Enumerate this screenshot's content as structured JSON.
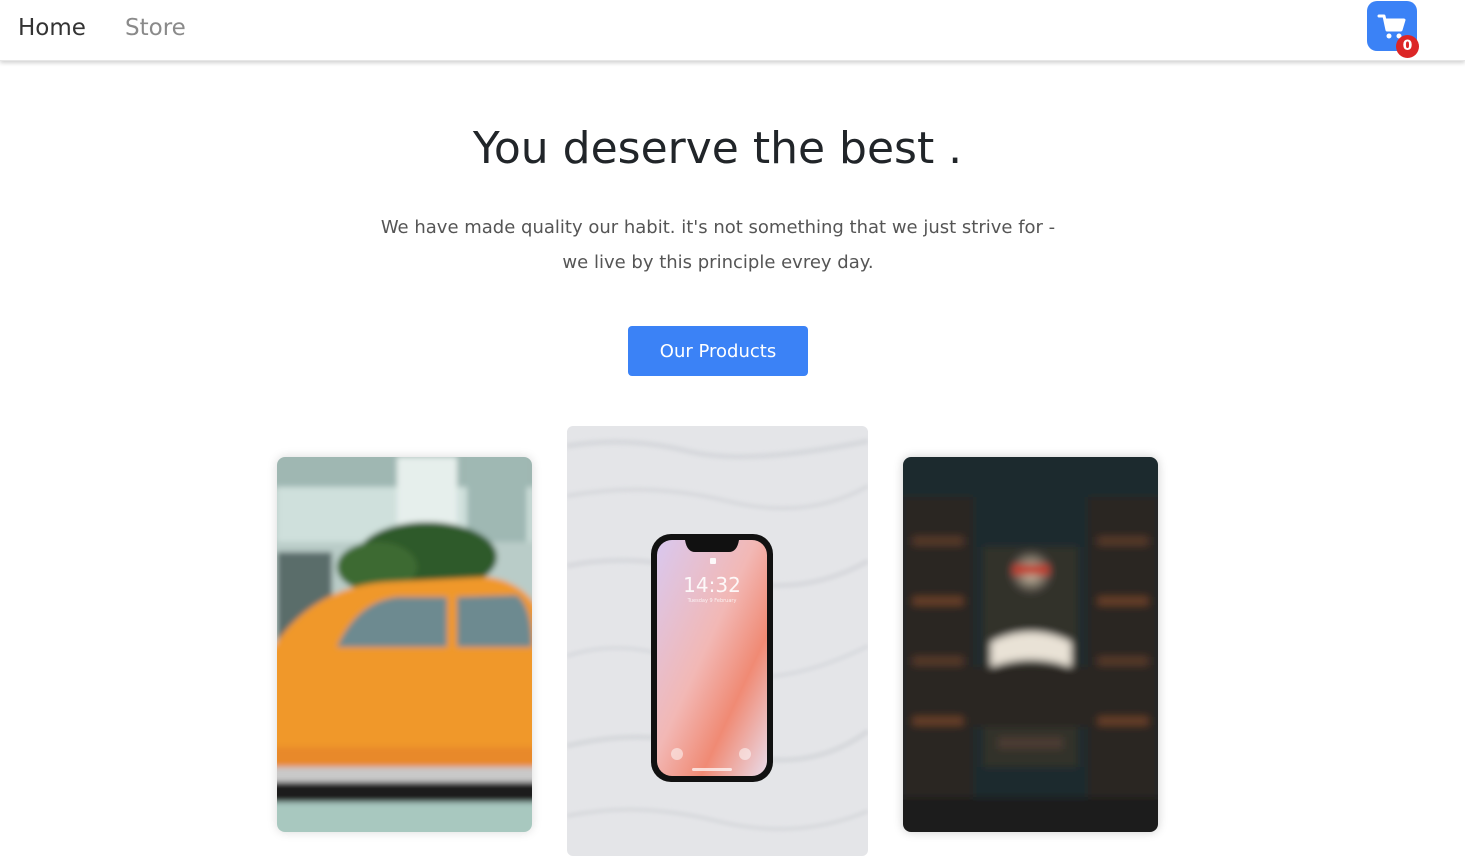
{
  "nav": {
    "home_label": "Home",
    "store_label": "Store"
  },
  "cart": {
    "icon": "cart-icon",
    "count": "0"
  },
  "hero": {
    "title": "You deserve the best .",
    "text": "We have made quality our habit. it's not something that we just strive for - we live by this principle evrey day.",
    "button_label": "Our Products"
  },
  "gallery": {
    "phone_time": "14:32",
    "phone_date": "Tuesday 9 February"
  },
  "colors": {
    "accent": "#3b82f6",
    "badge": "#dc2626"
  }
}
